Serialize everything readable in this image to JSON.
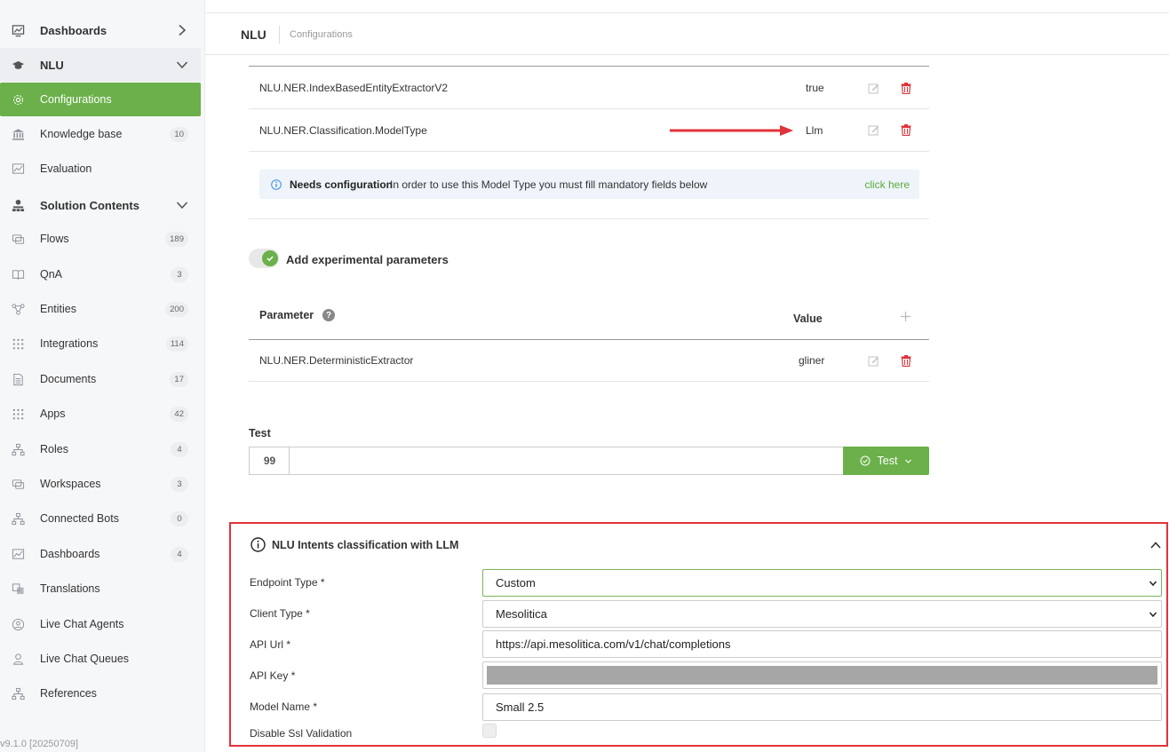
{
  "sidebar": {
    "items": [
      {
        "label": "Dashboards",
        "icon": "chart-line-icon",
        "type": "head",
        "chevron": "right"
      },
      {
        "label": "NLU",
        "icon": "graduation-cap-icon",
        "type": "head",
        "chevron": "down"
      },
      {
        "label": "Configurations",
        "icon": "gear-icon",
        "type": "active"
      },
      {
        "label": "Knowledge base",
        "icon": "bank-icon",
        "badge": "10"
      },
      {
        "label": "Evaluation",
        "icon": "chart-icon"
      },
      {
        "label": "Solution Contents",
        "icon": "sitemap-icon",
        "type": "head",
        "chevron": "down"
      },
      {
        "label": "Flows",
        "icon": "comments-icon",
        "badge": "189"
      },
      {
        "label": "QnA",
        "icon": "book-icon",
        "badge": "3"
      },
      {
        "label": "Entities",
        "icon": "network-icon",
        "badge": "200"
      },
      {
        "label": "Integrations",
        "icon": "grid-dots-icon",
        "badge": "114"
      },
      {
        "label": "Documents",
        "icon": "document-icon",
        "badge": "17"
      },
      {
        "label": "Apps",
        "icon": "grid-dots-icon",
        "badge": "42"
      },
      {
        "label": "Roles",
        "icon": "sitemap-icon",
        "badge": "4"
      },
      {
        "label": "Workspaces",
        "icon": "comments-icon",
        "badge": "3"
      },
      {
        "label": "Connected Bots",
        "icon": "sitemap-icon",
        "badge": "0"
      },
      {
        "label": "Dashboards",
        "icon": "chart-icon",
        "badge": "4"
      },
      {
        "label": "Translations",
        "icon": "translate-icon"
      },
      {
        "label": "Live Chat Agents",
        "icon": "user-circle-icon"
      },
      {
        "label": "Live Chat Queues",
        "icon": "user-queue-icon"
      },
      {
        "label": "References",
        "icon": "sitemap-icon"
      }
    ],
    "version": "v9.1.0 [20250709]"
  },
  "header": {
    "title": "NLU",
    "breadcrumb": "Configurations"
  },
  "config_rows": [
    {
      "key": "NLU.NER.IndexBasedEntityExtractorV2",
      "value": "true"
    },
    {
      "key": "NLU.NER.Classification.ModelType",
      "value": "Llm"
    }
  ],
  "notice": {
    "title": "Needs configuration",
    "message": "In order to use this Model Type you must fill mandatory fields below",
    "link": "click here"
  },
  "experimental": {
    "toggle_label": "Add experimental parameters",
    "enabled": true,
    "col_parameter": "Parameter",
    "col_value": "Value",
    "rows": [
      {
        "key": "NLU.NER.DeterministicExtractor",
        "value": "gliner"
      }
    ]
  },
  "test": {
    "label": "Test",
    "quote_symbol": "99",
    "button": "Test",
    "input_value": ""
  },
  "llm_panel": {
    "title": "NLU Intents classification with LLM",
    "fields": {
      "endpoint_type": {
        "label": "Endpoint Type *",
        "value": "Custom"
      },
      "client_type": {
        "label": "Client Type *",
        "value": "Mesolitica"
      },
      "api_url": {
        "label": "API Url *",
        "value": "https://api.mesolitica.com/v1/chat/completions"
      },
      "api_key": {
        "label": "API Key *"
      },
      "model_name": {
        "label": "Model Name *",
        "value": "Small 2.5"
      },
      "disable_ssl": {
        "label": "Disable Ssl Validation",
        "checked": false
      }
    }
  },
  "colors": {
    "accent": "#6bb04a",
    "danger": "#e0333a",
    "link": "#5aab3c",
    "info": "#3a8ee6"
  }
}
